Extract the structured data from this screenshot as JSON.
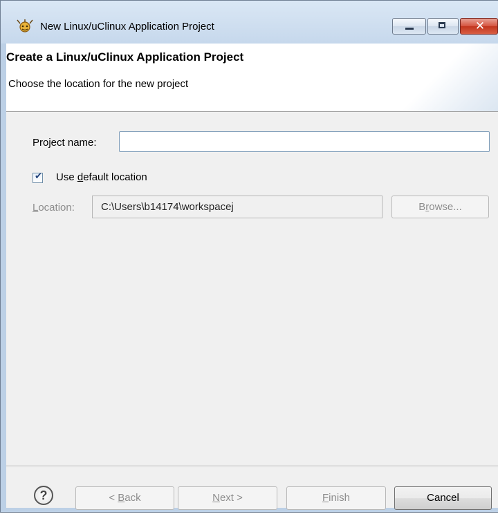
{
  "window": {
    "title": "New Linux/uClinux Application Project",
    "icon": "eclipse-wizard-icon",
    "controls": [
      "minimize-icon",
      "maximize-icon",
      "close-icon"
    ]
  },
  "banner": {
    "title": "Create a Linux/uClinux Application Project",
    "subtitle": "Choose the location for the new project"
  },
  "form": {
    "project_name_label": "Project name:",
    "project_name_value": "",
    "use_default_location": {
      "checked": true,
      "label_pre": "Use ",
      "label_mnemonic": "d",
      "label_post": "efault location"
    },
    "location_label_mnemonic": "L",
    "location_label_rest": "ocation:",
    "location_value": "C:\\Users\\b14174\\workspacej",
    "browse": {
      "pre": "B",
      "mnemonic": "r",
      "post": "owse..."
    }
  },
  "footer": {
    "help_glyph": "?",
    "back": {
      "pre": "< ",
      "mnemonic": "B",
      "post": "ack"
    },
    "next": {
      "mnemonic": "N",
      "post": "ext >"
    },
    "finish": {
      "mnemonic": "F",
      "post": "inish"
    },
    "cancel": "Cancel"
  },
  "colors": {
    "frame": "#bcd0e6",
    "client_bg": "#f0f0f0",
    "disabled_text": "#8d8d8d",
    "close_button": "#c2351e"
  }
}
